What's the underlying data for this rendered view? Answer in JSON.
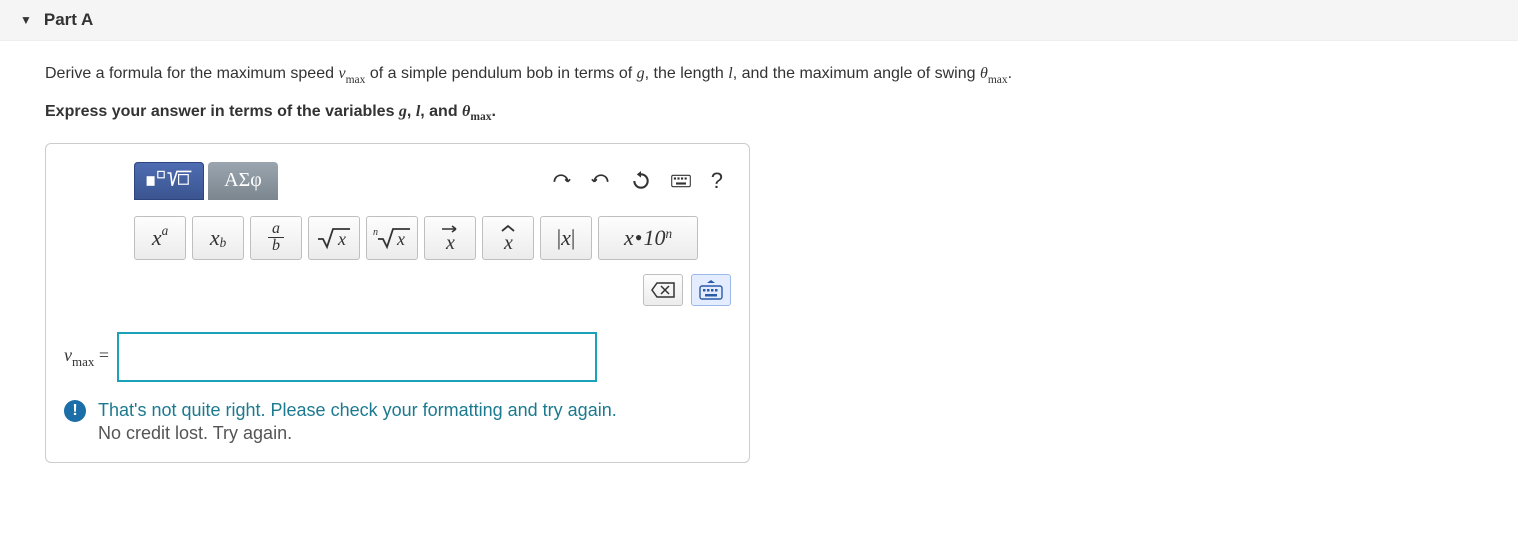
{
  "header": {
    "title": "Part A"
  },
  "prompt": {
    "p1_a": "Derive a formula for the maximum speed ",
    "p1_v": "v",
    "p1_vsub": "max",
    "p1_b": " of a simple pendulum bob in terms of ",
    "p1_g": "g",
    "p1_c": ", the length ",
    "p1_l": "l",
    "p1_d": ", and the maximum angle of swing ",
    "p1_th": "θ",
    "p1_thsub": "max",
    "p1_end": "."
  },
  "instruct": {
    "a": "Express your answer in terms of the variables ",
    "g": "g",
    "c1": ", ",
    "l": "l",
    "c2": ", and ",
    "th": "θ",
    "thsub": "max",
    "end": "."
  },
  "tabs": {
    "greek": "ΑΣφ"
  },
  "toolbar": {
    "help": "?"
  },
  "palette": {
    "sup": "x",
    "sup_a": "a",
    "sub": "x",
    "sub_b": "b",
    "frac_a": "a",
    "frac_b": "b",
    "sqrt": "x",
    "nroot_n": "n",
    "nroot_x": "x",
    "vec": "x",
    "hat": "x",
    "abs": "|x|",
    "sci_x": "x",
    "sci_dot": "•",
    "sci_10": "10",
    "sci_n": "n"
  },
  "answer": {
    "label_v": "v",
    "label_sub": "max",
    "label_eq": " =",
    "value": ""
  },
  "feedback": {
    "icon": "!",
    "main": "That's not quite right. Please check your formatting and try again.",
    "sub": "No credit lost. Try again."
  }
}
